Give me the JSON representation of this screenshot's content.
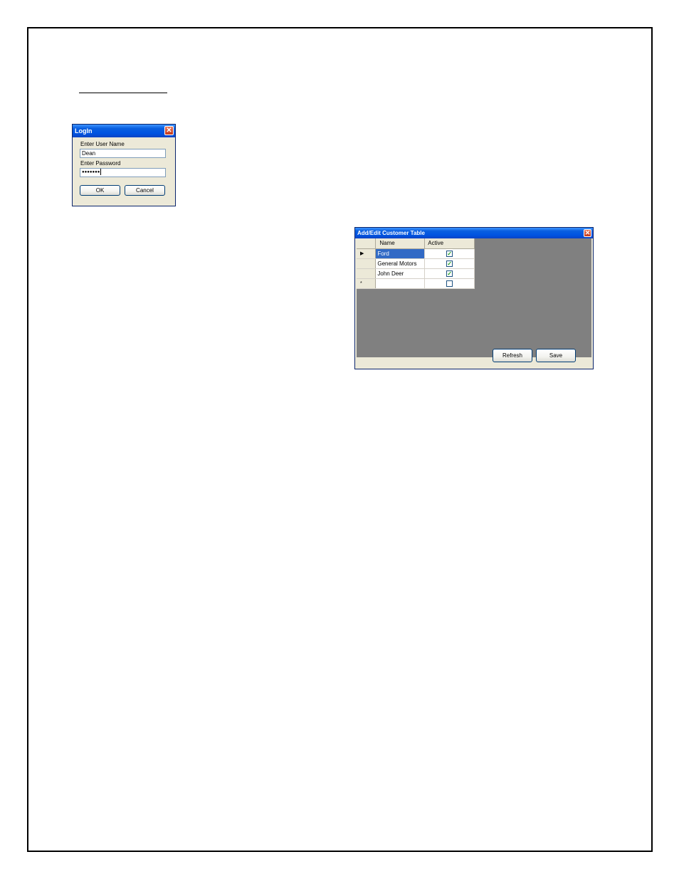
{
  "login": {
    "title": "LogIn",
    "close_glyph": "✕",
    "username_label": "Enter User Name",
    "username_value": "Dean",
    "password_label": "Enter Password",
    "password_value": "●●●●●●●",
    "ok_label": "OK",
    "cancel_label": "Cancel"
  },
  "customer_window": {
    "title": "Add/Edit Customer Table",
    "close_glyph": "✕",
    "columns": [
      "Name",
      "Active"
    ],
    "rows": [
      {
        "indicator": "▶",
        "name": "Ford",
        "active": true,
        "active_glyph": "✓",
        "selected": true
      },
      {
        "indicator": "",
        "name": "General Motors",
        "active": true,
        "active_glyph": "✓",
        "selected": false
      },
      {
        "indicator": "",
        "name": "John Deer",
        "active": true,
        "active_glyph": "✓",
        "selected": false
      },
      {
        "indicator": "*",
        "name": "",
        "active": false,
        "active_glyph": "",
        "selected": false
      }
    ],
    "refresh_label": "Refresh",
    "save_label": "Save"
  },
  "colors": {
    "titlebar": "#0053e1",
    "selection": "#316ac5",
    "grid_background": "#808080",
    "dialog_face": "#ece9d8"
  }
}
